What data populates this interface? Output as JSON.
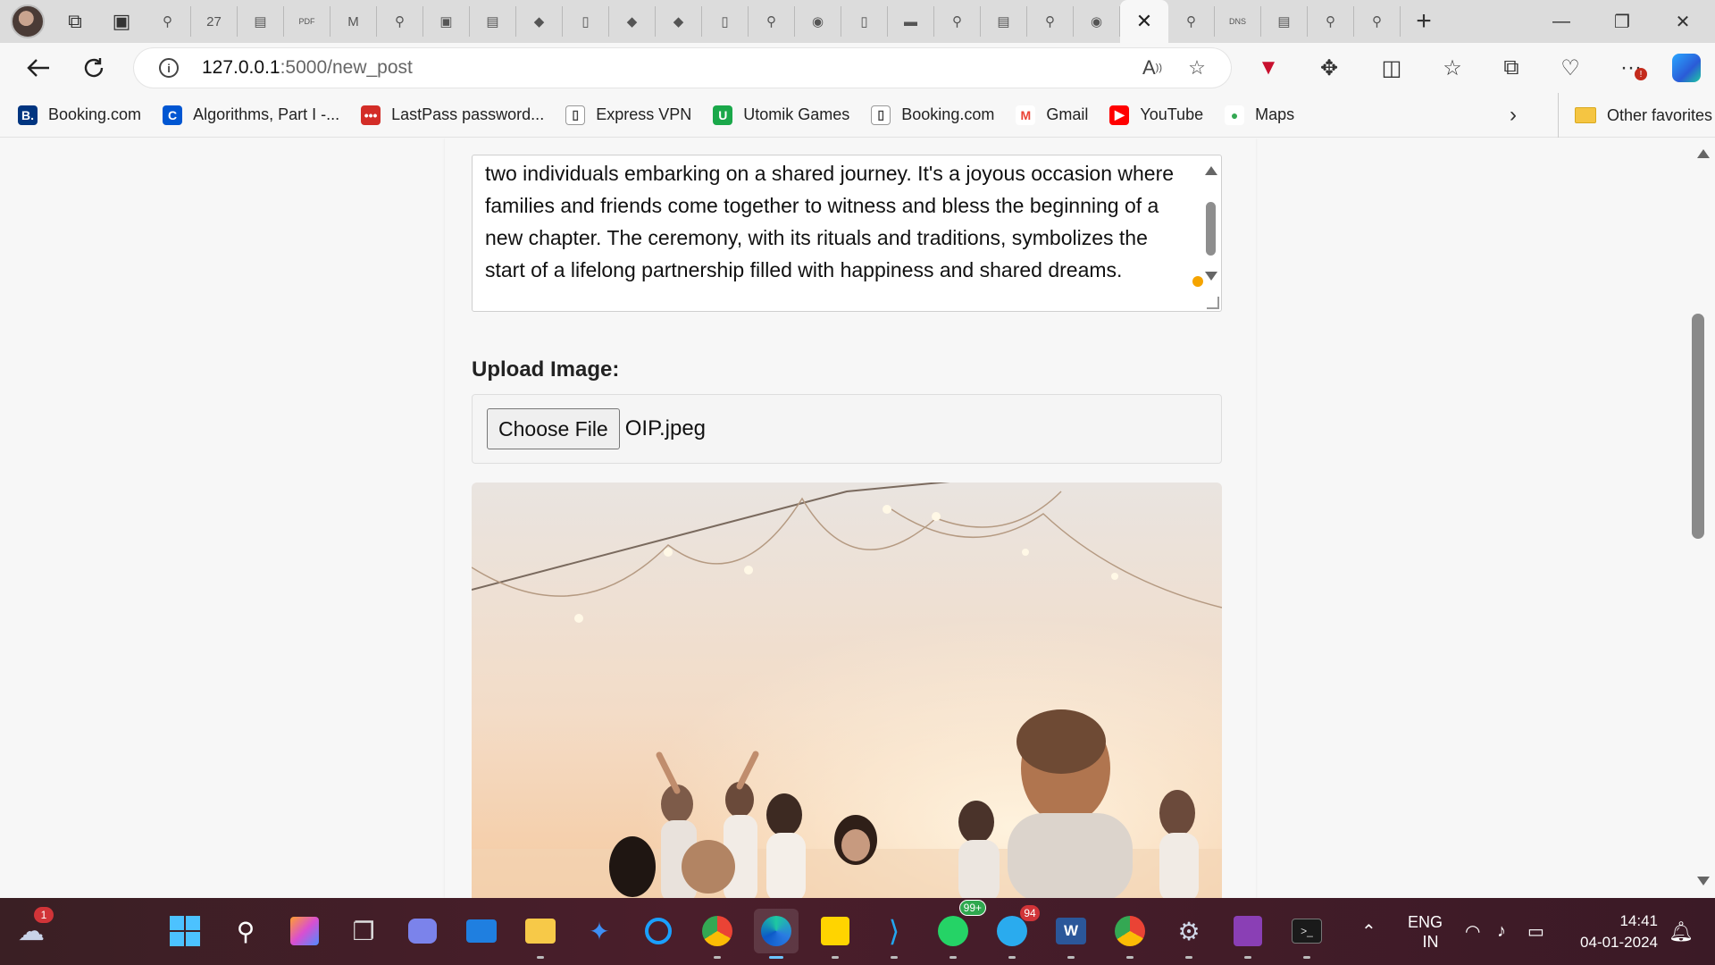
{
  "browser": {
    "address": {
      "host": "127.0.0.1",
      "path": ":5000/new_post"
    },
    "active_tab_close": "✕",
    "new_tab": "+",
    "window": {
      "minimize": "—",
      "maximize": "❐",
      "close": "✕"
    }
  },
  "tabs": [
    {
      "icon": "search-icon",
      "glyph": "⚲"
    },
    {
      "icon": "calendar-27-icon",
      "glyph": "27"
    },
    {
      "icon": "app-icon",
      "glyph": "▤"
    },
    {
      "icon": "pdf-icon",
      "glyph": "PDF"
    },
    {
      "icon": "gmail-icon",
      "glyph": "M"
    },
    {
      "icon": "search-icon",
      "glyph": "⚲"
    },
    {
      "icon": "image-icon",
      "glyph": "▣"
    },
    {
      "icon": "app-icon",
      "glyph": "▤"
    },
    {
      "icon": "shield-icon",
      "glyph": "◆"
    },
    {
      "icon": "page-icon",
      "glyph": "▯"
    },
    {
      "icon": "shield-icon",
      "glyph": "◆"
    },
    {
      "icon": "shield-icon",
      "glyph": "◆"
    },
    {
      "icon": "page-icon",
      "glyph": "▯"
    },
    {
      "icon": "search-icon",
      "glyph": "⚲"
    },
    {
      "icon": "github-icon",
      "glyph": "◉"
    },
    {
      "icon": "page-icon",
      "glyph": "▯"
    },
    {
      "icon": "video-icon",
      "glyph": "▬"
    },
    {
      "icon": "search-icon",
      "glyph": "⚲"
    },
    {
      "icon": "app-icon",
      "glyph": "▤"
    },
    {
      "icon": "search-icon",
      "glyph": "⚲"
    },
    {
      "icon": "github-icon",
      "glyph": "◉"
    }
  ],
  "tabs_after": [
    {
      "icon": "search-icon",
      "glyph": "⚲"
    },
    {
      "icon": "dns-icon",
      "glyph": "DNS"
    },
    {
      "icon": "app-icon",
      "glyph": "▤"
    },
    {
      "icon": "search-icon",
      "glyph": "⚲"
    },
    {
      "icon": "search-icon",
      "glyph": "⚲"
    }
  ],
  "favorites": [
    {
      "label": "Booking.com",
      "icon": "booking-icon",
      "glyph": "B.",
      "color": "#003580"
    },
    {
      "label": "Algorithms, Part I -...",
      "icon": "coursera-icon",
      "glyph": "C",
      "color": "#0056d2"
    },
    {
      "label": "LastPass password...",
      "icon": "lastpass-icon",
      "glyph": "•••",
      "color": "#d32d27"
    },
    {
      "label": "Express VPN",
      "icon": "page-icon",
      "glyph": "▯",
      "color": "#ffffff"
    },
    {
      "label": "Utomik Games",
      "icon": "utomik-icon",
      "glyph": "U",
      "color": "#1aa84a"
    },
    {
      "label": "Booking.com",
      "icon": "page-icon",
      "glyph": "▯",
      "color": "#ffffff"
    },
    {
      "label": "Gmail",
      "icon": "gmail-icon",
      "glyph": "M",
      "color": "#ffffff"
    },
    {
      "label": "YouTube",
      "icon": "youtube-icon",
      "glyph": "▶",
      "color": "#ff0000"
    },
    {
      "label": "Maps",
      "icon": "maps-icon",
      "glyph": "●",
      "color": "#ffffff"
    }
  ],
  "favorites_other": "Other favorites",
  "form": {
    "content_text": "two individuals embarking on a shared journey. It's a joyous occasion where families and friends come together to witness and bless the beginning of a new chapter. The ceremony, with its rituals and traditions, symbolizes the start of a lifelong partnership filled with happiness and shared dreams.",
    "upload_label": "Upload Image:",
    "choose_file_button": "Choose File",
    "file_name": "OIP.jpeg"
  },
  "taskbar": {
    "weather_badge": "1",
    "whatsapp_badge": "99+",
    "telegram_badge": "94",
    "language": "ENG",
    "region": "IN",
    "time": "14:41",
    "date": "04-01-2024"
  },
  "colors": {
    "accent": "#0078d4",
    "tab_strip": "#dcdcdc",
    "page_bg": "#f7f7f7",
    "taskbar": "#3e1d27"
  }
}
